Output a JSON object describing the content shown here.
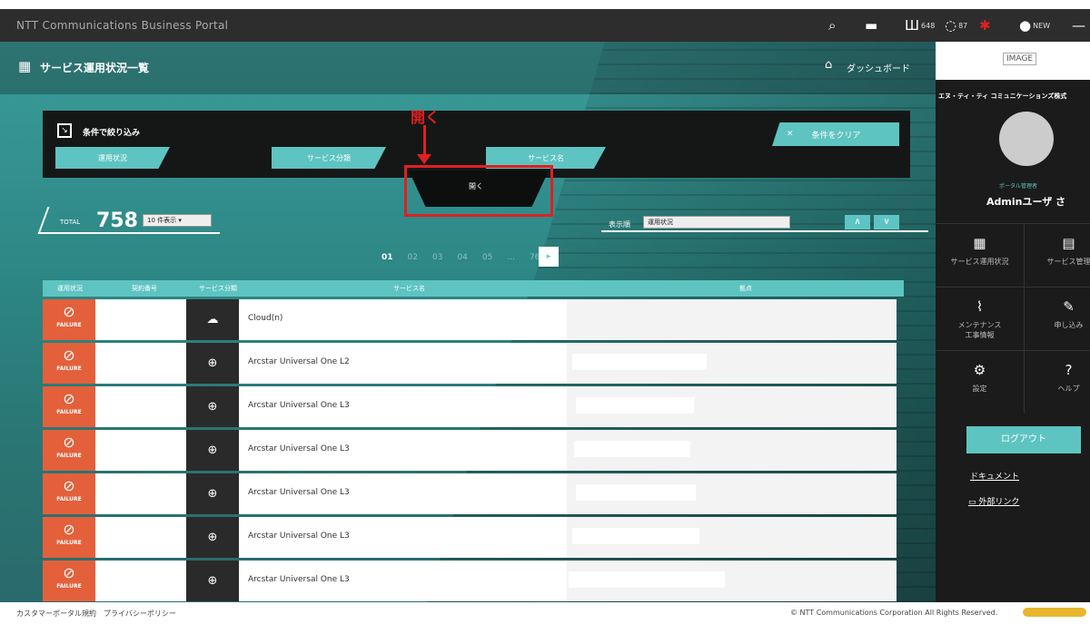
{
  "topbar": {
    "title": "NTT Communications Business Portal",
    "icons": [
      {
        "name": "search-icon",
        "glyph": "⌕"
      },
      {
        "name": "chat-icon",
        "glyph": "▬"
      },
      {
        "name": "network-icon",
        "glyph": "Ш",
        "badge": "648"
      },
      {
        "name": "status-ring-icon",
        "glyph": "◌",
        "badge": "87"
      },
      {
        "name": "alert-icon",
        "glyph": "✱"
      },
      {
        "name": "info-icon",
        "glyph": "●",
        "badge": "NEW"
      },
      {
        "name": "minimize-icon",
        "glyph": "—"
      }
    ]
  },
  "page": {
    "title": "サービス運用状況一覧",
    "home_label": "ダッシュボード"
  },
  "filter": {
    "label": "条件で絞り込み",
    "clear_label": "条件をクリア",
    "tabs": [
      "運用状況",
      "サービス分類",
      "サービス名"
    ],
    "open_tab_label": "開く"
  },
  "annotation": {
    "label": "開く",
    "color": "#e02020"
  },
  "summary": {
    "total_label": "TOTAL",
    "total": "758",
    "per_page": "10 件表示",
    "sort_label": "表示順",
    "sort_value": "運用状況"
  },
  "pagination": {
    "pages": [
      "01",
      "02",
      "03",
      "04",
      "05",
      "...",
      "76"
    ],
    "current": "01"
  },
  "table": {
    "headers": [
      "運用状況",
      "契約番号",
      "サービス分類",
      "サービス名",
      "拠点"
    ],
    "rows": [
      {
        "status": "FAILURE",
        "category_icon": "cloud-icon",
        "name": "Cloud(n)"
      },
      {
        "status": "FAILURE",
        "category_icon": "globe-icon",
        "name": "Arcstar Universal One L2"
      },
      {
        "status": "FAILURE",
        "category_icon": "globe-icon",
        "name": "Arcstar Universal One L3"
      },
      {
        "status": "FAILURE",
        "category_icon": "globe-icon",
        "name": "Arcstar Universal One L3"
      },
      {
        "status": "FAILURE",
        "category_icon": "globe-icon",
        "name": "Arcstar Universal One L3"
      },
      {
        "status": "FAILURE",
        "category_icon": "globe-icon",
        "name": "Arcstar Universal One L3"
      },
      {
        "status": "FAILURE",
        "category_icon": "globe-icon",
        "name": "Arcstar Universal One L3"
      }
    ]
  },
  "sidebar": {
    "logo_text": "IMAGE",
    "company": "エヌ・ティ・ティ コミュニケーションズ株式",
    "role": "ポータル管理者",
    "username": "Adminユーザ さ",
    "menu": [
      {
        "icon": "grid-icon",
        "glyph": "▦",
        "label": "サービス運用状況"
      },
      {
        "icon": "document-icon",
        "glyph": "▤",
        "label": "サービス管理"
      },
      {
        "icon": "maintenance-icon",
        "glyph": "⌇",
        "label": "メンテナンス\n工事情報"
      },
      {
        "icon": "edit-icon",
        "glyph": "✎",
        "label": "申し込み"
      },
      {
        "icon": "gear-icon",
        "glyph": "⚙",
        "label": "設定"
      },
      {
        "icon": "help-icon",
        "glyph": "?",
        "label": "ヘルプ"
      }
    ],
    "logout_label": "ログアウト",
    "document_label": "ドキュメント",
    "external_label": "外部リンク"
  },
  "footer": {
    "left": "カスタマーポータル規約　プライバシーポリシー",
    "right": "© NTT Communications Corporation All Rights Reserved."
  },
  "colors": {
    "accent": "#5ec4c1",
    "failure": "#e3603b",
    "dark": "#151717"
  }
}
